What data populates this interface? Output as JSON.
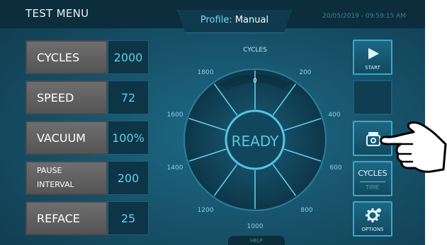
{
  "header": {
    "title": "TEST MENU",
    "profile_label": "Profile:",
    "profile_value": "Manual",
    "datetime": "20/05/2019 - 09:59:15 AM"
  },
  "params": [
    {
      "label": "CYCLES",
      "value": "2000"
    },
    {
      "label": "SPEED",
      "value": "72"
    },
    {
      "label": "VACUUM",
      "value": "100%"
    },
    {
      "label_line1": "PAUSE",
      "label_line2": "INTERVAL",
      "value": "200"
    },
    {
      "label": "REFACE",
      "value": "25"
    }
  ],
  "dial": {
    "title": "CYCLES",
    "status": "READY",
    "scale": [
      "0",
      "200",
      "400",
      "600",
      "800",
      "1000",
      "1200",
      "1400",
      "1600",
      "1800"
    ]
  },
  "buttons": {
    "start": "START",
    "cycles": "CYCLES",
    "time": "TIME",
    "options": "OPTIONS"
  },
  "help": "HELP",
  "colors": {
    "background": "#164f66",
    "top_bar": "#0b2d3c",
    "value_text": "#5fd0ee",
    "label_box": "#636363",
    "accent": "#37a9c9"
  }
}
